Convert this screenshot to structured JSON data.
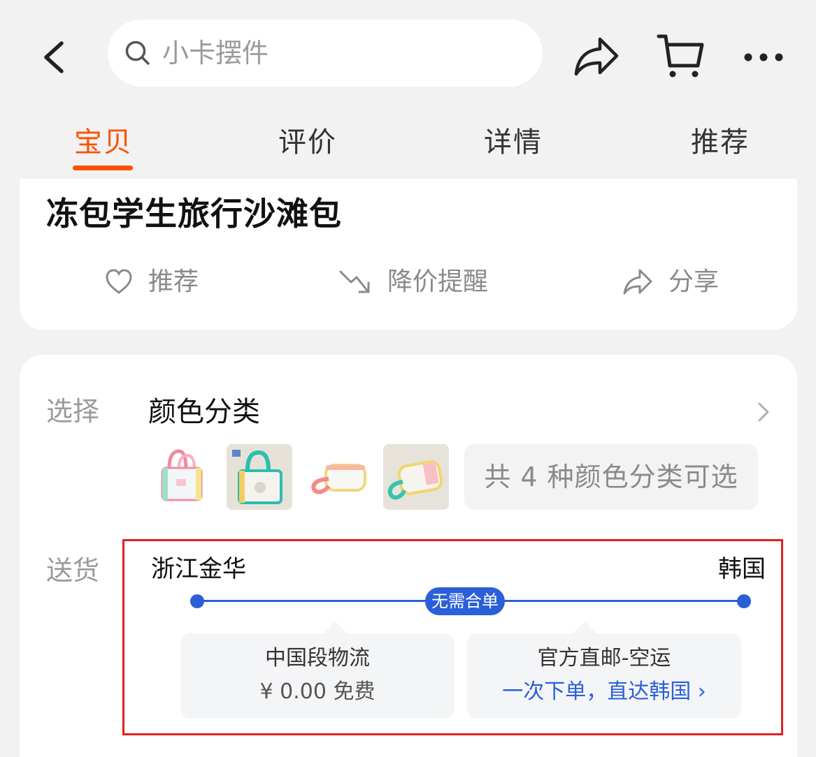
{
  "search": {
    "placeholder": "小卡摆件"
  },
  "tabs": [
    {
      "label": "宝贝",
      "active": true
    },
    {
      "label": "评价",
      "active": false
    },
    {
      "label": "详情",
      "active": false
    },
    {
      "label": "推荐",
      "active": false
    }
  ],
  "product": {
    "title_line2": "冻包学生旅行沙滩包"
  },
  "actions": {
    "recommend": "推荐",
    "price_alert": "降价提醒",
    "share": "分享"
  },
  "select": {
    "label": "选择",
    "title": "颜色分类",
    "more_text": "共 4 种颜色分类可选"
  },
  "shipping": {
    "label": "送货",
    "origin": "浙江金华",
    "destination": "韩国",
    "badge": "无需合单",
    "leg1_title": "中国段物流",
    "leg1_detail": "¥ 0.00 免费",
    "leg2_title": "官方直邮-空运",
    "leg2_detail": "一次下单，直达韩国 ›"
  },
  "colors": {
    "accent": "#ff5000",
    "link": "#2a5fd8",
    "highlight_border": "#e02020"
  },
  "icons": [
    "back-arrow-icon",
    "search-icon",
    "share-icon",
    "cart-icon",
    "more-icon",
    "heart-icon",
    "price-down-icon",
    "chevron-right-icon"
  ]
}
